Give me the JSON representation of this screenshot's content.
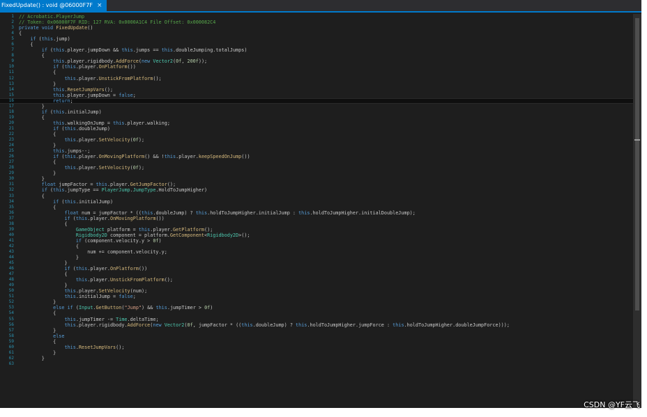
{
  "tab": {
    "title": "FixedUpdate() : void @06000F7F",
    "close_glyph": "×"
  },
  "watermark": "CSDN @YF云飞",
  "highlight_line": 16,
  "colors": {
    "editor_bg": "#1e1e1e",
    "keyword": "#569cd6",
    "method": "#d7ba7d",
    "type": "#4ec9b0",
    "comment": "#57a64a",
    "number": "#b5cea8",
    "string": "#d69d85",
    "text": "#c8c8c8",
    "line_number": "#2b91af",
    "accent": "#007acc"
  },
  "code_lines": [
    "// Acrobatic.PlayerJump",
    "// Token: 0x06000F7F RID: 127 RVA: 0x0000A1C4 File Offset: 0x000082C4",
    "private void FixedUpdate()",
    "{",
    "    if (this.jump)",
    "    {",
    "        if (this.player.jumpDown && this.jumps == this.doubleJumping.totalJumps)",
    "        {",
    "            this.player.rigidbody.AddForce(new Vector2(0f, 200f));",
    "            if (this.player.OnPlatform())",
    "            {",
    "                this.player.UnstickFromPlatform();",
    "            }",
    "            this.ResetJumpVars();",
    "            this.player.jumpDown = false;",
    "            return;",
    "        }",
    "        if (this.initialJump)",
    "        {",
    "            this.walkingOnJump = this.player.walking;",
    "            if (this.doubleJump)",
    "            {",
    "                this.player.SetVelocity(0f);",
    "            }",
    "            this.jumps--;",
    "            if (this.player.OnMovingPlatform() && !this.player.keepSpeedOnJump())",
    "            {",
    "                this.player.SetVelocity(0f);",
    "            }",
    "        }",
    "        float jumpFactor = this.player.GetJumpFactor();",
    "        if (this.jumpType == PlayerJump.JumpType.HoldToJumpHigher)",
    "        {",
    "            if (this.initialJump)",
    "            {",
    "                float num = jumpFactor * ((this.doubleJump) ? this.holdToJumpHigher.initialJump : this.holdToJumpHigher.initialDoubleJump);",
    "                if (this.player.OnMovingPlatform())",
    "                {",
    "                    GameObject platform = this.player.GetPlatform();",
    "                    Rigidbody2D component = platform.GetComponent<Rigidbody2D>();",
    "                    if (component.velocity.y > 0f)",
    "                    {",
    "                        num += component.velocity.y;",
    "                    }",
    "                }",
    "                if (this.player.OnPlatform())",
    "                {",
    "                    this.player.UnstickFromPlatform();",
    "                }",
    "                this.player.SetVelocity(num);",
    "                this.initialJump = false;",
    "            }",
    "            else if (Input.GetButton(\"Jump\") && this.jumpTimer > 0f)",
    "            {",
    "                this.jumpTimer -= Time.deltaTime;",
    "                this.player.rigidbody.AddForce(new Vector2(0f, jumpFactor * ((this.doubleJump) ? this.holdToJumpHigher.jumpForce : this.holdToJumpHigher.doubleJumpForce)));",
    "            }",
    "            else",
    "            {",
    "                this.ResetJumpVars();",
    "            }",
    "        }",
    "        "
  ]
}
